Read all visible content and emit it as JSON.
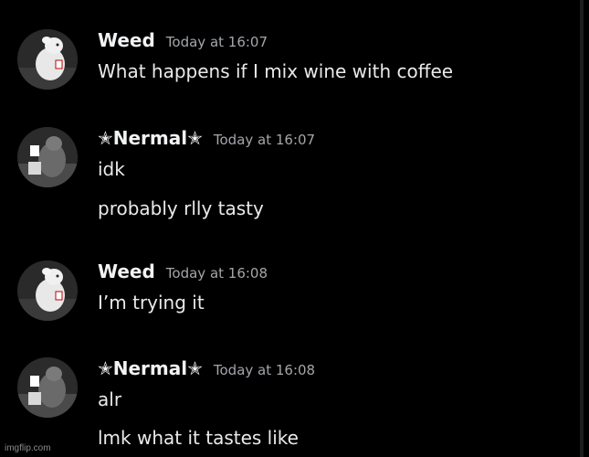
{
  "messages": [
    {
      "username": "Weed",
      "timestamp": "Today at 16:07",
      "avatar_icon": "white-rat-avatar",
      "lines": [
        "What happens if I mix wine with coffee"
      ]
    },
    {
      "username": "✭Nermal✭",
      "timestamp": "Today at 16:07",
      "avatar_icon": "gray-rat-avatar",
      "lines": [
        "idk",
        "probably rlly tasty"
      ]
    },
    {
      "username": "Weed",
      "timestamp": "Today at 16:08",
      "avatar_icon": "white-rat-avatar",
      "lines": [
        "I’m trying it"
      ]
    },
    {
      "username": "✭Nermal✭",
      "timestamp": "Today at 16:08",
      "avatar_icon": "gray-rat-avatar",
      "lines": [
        "alr",
        "lmk what it tastes like"
      ]
    }
  ],
  "watermark": "imgflip.com",
  "colors": {
    "background": "#000000",
    "username": "#f2f3f5",
    "timestamp": "#a3a6aa",
    "message_text": "#eaeaea"
  }
}
